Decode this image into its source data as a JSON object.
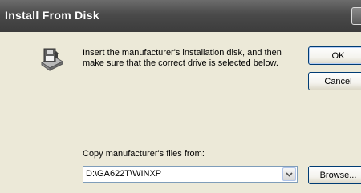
{
  "window": {
    "title": "Install From Disk"
  },
  "message": "Insert the manufacturer's installation disk, and then make sure that the correct drive is selected below.",
  "buttons": {
    "ok": "OK",
    "cancel": "Cancel",
    "browse": "Browse..."
  },
  "copy": {
    "label": "Copy manufacturer's files from:",
    "value": "D:\\GA622T\\WINXP"
  },
  "icons": {
    "install": "disk-install-icon",
    "dropdown": "chevron-down-icon",
    "close": "close-icon"
  },
  "colors": {
    "titlebar": "#4a4a4a",
    "dialog_bg": "#ece9d8",
    "button_border": "#003c74"
  }
}
